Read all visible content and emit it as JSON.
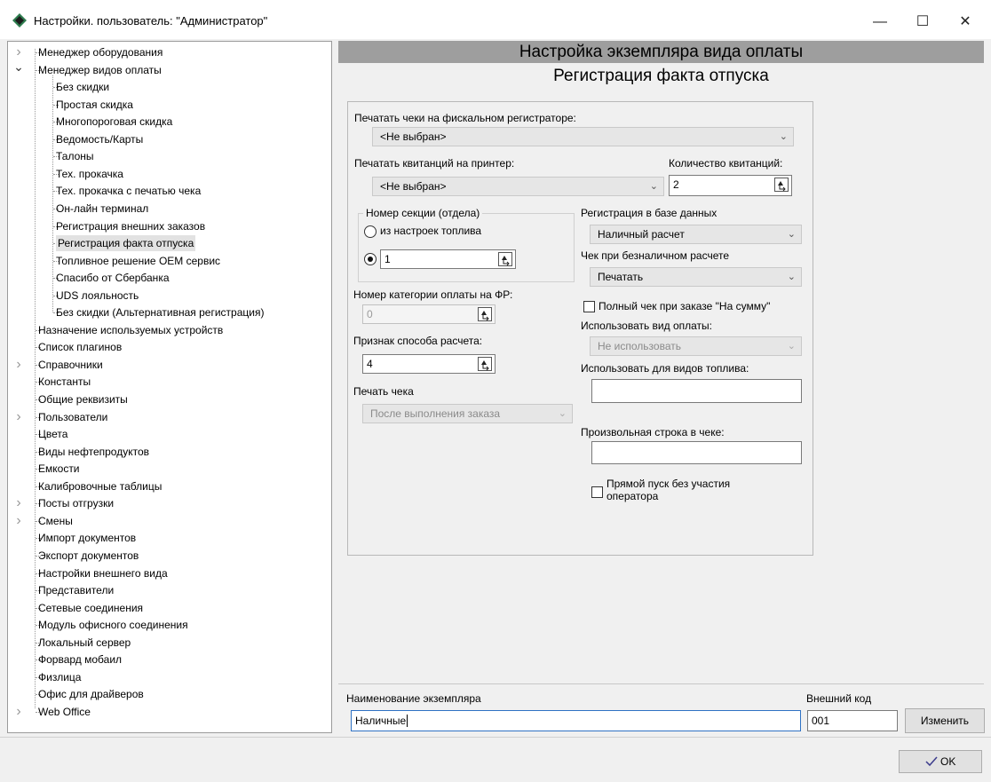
{
  "window": {
    "title": "Настройки. пользователь: \"Администратор\"",
    "buttons": [
      "—",
      "☐",
      "✕"
    ]
  },
  "tree": [
    {
      "label": "Менеджер оборудования",
      "level": 0,
      "toggle": "closed"
    },
    {
      "label": "Менеджер видов оплаты",
      "level": 0,
      "toggle": "open"
    },
    {
      "label": "Без скидки",
      "level": 1
    },
    {
      "label": "Простая скидка",
      "level": 1
    },
    {
      "label": "Многопороговая скидка",
      "level": 1
    },
    {
      "label": "Ведомость/Карты",
      "level": 1
    },
    {
      "label": "Талоны",
      "level": 1
    },
    {
      "label": "Тех. прокачка",
      "level": 1
    },
    {
      "label": "Тех. прокачка с печатью чека",
      "level": 1
    },
    {
      "label": "Он-лайн терминал",
      "level": 1
    },
    {
      "label": "Регистрация внешних заказов",
      "level": 1
    },
    {
      "label": "Регистрация факта отпуска",
      "level": 1,
      "selected": true
    },
    {
      "label": "Топливное решение ОЕМ сервис",
      "level": 1
    },
    {
      "label": "Спасибо от Сбербанка",
      "level": 1
    },
    {
      "label": "UDS лояльность",
      "level": 1
    },
    {
      "label": "Без скидки (Альтернативная регистрация)",
      "level": 1
    },
    {
      "label": "Назначение используемых устройств",
      "level": 0
    },
    {
      "label": "Список плагинов",
      "level": 0
    },
    {
      "label": "Справочники",
      "level": 0,
      "toggle": "closed"
    },
    {
      "label": "Константы",
      "level": 0
    },
    {
      "label": "Общие реквизиты",
      "level": 0
    },
    {
      "label": "Пользователи",
      "level": 0,
      "toggle": "closed"
    },
    {
      "label": "Цвета",
      "level": 0
    },
    {
      "label": "Виды нефтепродуктов",
      "level": 0
    },
    {
      "label": "Емкости",
      "level": 0
    },
    {
      "label": "Калибровочные таблицы",
      "level": 0
    },
    {
      "label": "Посты отгрузки",
      "level": 0,
      "toggle": "closed"
    },
    {
      "label": "Смены",
      "level": 0,
      "toggle": "closed"
    },
    {
      "label": "Импорт документов",
      "level": 0
    },
    {
      "label": "Экспорт документов",
      "level": 0
    },
    {
      "label": "Настройки внешнего вида",
      "level": 0
    },
    {
      "label": "Представители",
      "level": 0
    },
    {
      "label": "Сетевые соединения",
      "level": 0
    },
    {
      "label": "Модуль офисного соединения",
      "level": 0
    },
    {
      "label": "Локальный сервер",
      "level": 0
    },
    {
      "label": "Форвард мобаил",
      "level": 0
    },
    {
      "label": "Физлица",
      "level": 0
    },
    {
      "label": "Офис для драйверов",
      "level": 0
    },
    {
      "label": "Web Office",
      "level": 0,
      "toggle": "closed"
    }
  ],
  "main": {
    "header": "Настройка экземпляра вида оплаты",
    "subheader": "Регистрация факта отпуска"
  },
  "form": {
    "fiscal_printer_label": "Печатать чеки на фискальном регистраторе:",
    "fiscal_printer_value": "<Не выбран>",
    "receipt_printer_label": "Печатать квитанций на принтер:",
    "receipt_printer_value": "<Не выбран>",
    "receipt_count_label": "Количество квитанций:",
    "receipt_count_value": "2",
    "section_group_label": "Номер секции (отдела)",
    "section_radio1_label": "из настроек топлива",
    "section_value": "1",
    "pay_category_label": "Номер категории оплаты на ФР:",
    "pay_category_value": "0",
    "calc_method_label": "Признак способа расчета:",
    "calc_method_value": "4",
    "print_receipt_label": "Печать чека",
    "print_receipt_value": "После выполнения заказа",
    "db_reg_label": "Регистрация в базе данных",
    "db_reg_value": "Наличный расчет",
    "cashless_label": "Чек при безналичном расчете",
    "cashless_value": "Печатать",
    "full_check_label": "Полный чек при заказе \"На сумму\"",
    "use_pay_type_label": "Использовать вид оплаты:",
    "use_pay_type_value": "Не использовать",
    "fuel_types_label": "Использовать для видов топлива:",
    "fuel_types_value": "",
    "custom_line_label": "Произвольная строка в чеке:",
    "custom_line_value": "",
    "direct_start_label_1": "Прямой пуск без участия",
    "direct_start_label_2": "оператора"
  },
  "bottom": {
    "instance_name_label": "Наименование экземпляра",
    "instance_name_value": "Наличные",
    "ext_code_label": "Внешний код",
    "ext_code_value": "001",
    "change_button": "Изменить",
    "ok_button": "OK"
  }
}
